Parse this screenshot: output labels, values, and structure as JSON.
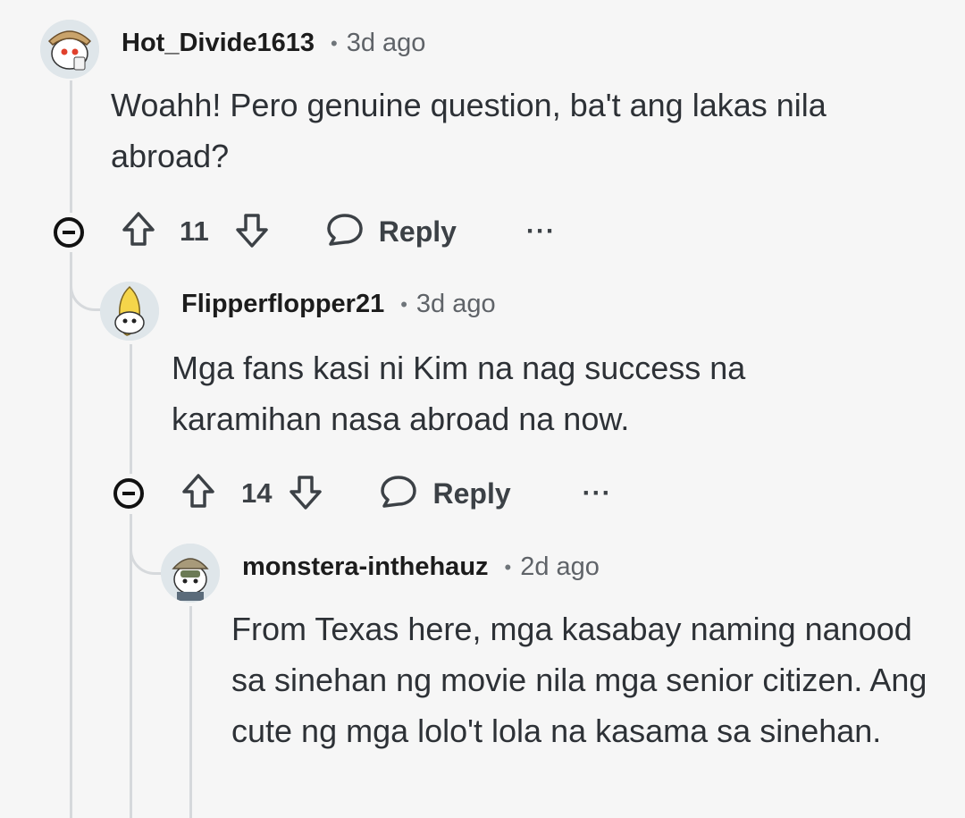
{
  "comments": [
    {
      "username": "Hot_Divide1613",
      "time": "3d ago",
      "dot": "•",
      "body": "Woahh! Pero genuine question, ba't ang lakas nila abroad?",
      "votes": "11",
      "reply_label": "Reply",
      "more": "···"
    },
    {
      "username": "Flipperflopper21",
      "time": "3d ago",
      "dot": "•",
      "body": "Mga fans kasi ni Kim na nag success na karamihan nasa abroad na now.",
      "votes": "14",
      "reply_label": "Reply",
      "more": "···"
    },
    {
      "username": "monstera-inthehauz",
      "time": "2d ago",
      "dot": "•",
      "body": "From Texas here, mga kasabay naming nanood sa sinehan ng movie nila mga senior citizen. Ang cute ng mga lolo't lola na kasama sa sinehan."
    }
  ],
  "icons": {
    "collapse": "minus-circle-icon",
    "upvote": "arrow-up-icon",
    "downvote": "arrow-down-icon",
    "reply": "speech-bubble-icon",
    "more": "ellipsis-icon"
  },
  "colors": {
    "background": "#f6f6f6",
    "thread_line": "#d6d9dc",
    "text": "#2d3136"
  }
}
